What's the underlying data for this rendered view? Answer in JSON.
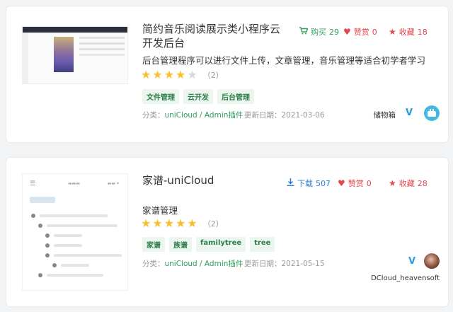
{
  "cards": [
    {
      "title_line1": "简约音乐阅读展示类小程序云",
      "title_line2": "开发后台",
      "stats": {
        "buy_label": "购买",
        "buy_count": "29",
        "like_label": "赞赏",
        "like_count": "0",
        "fav_label": "收藏",
        "fav_count": "18"
      },
      "description": "后台管理程序可以进行文件上传，文章管理，音乐管理等适合初学者学习",
      "rating": 4,
      "rating_count": "（2）",
      "tags": [
        "文件管理",
        "云开发",
        "后台管理"
      ],
      "category_label": "分类：",
      "category_value": "uniCloud / Admin插件",
      "date_label": "更新日期：",
      "date_value": "2021-03-06",
      "author": "储物箱"
    },
    {
      "title": "家谱-uniCloud",
      "stats": {
        "download_label": "下载",
        "download_count": "507",
        "like_label": "赞赏",
        "like_count": "0",
        "fav_label": "收藏",
        "fav_count": "28"
      },
      "description": "家谱管理",
      "rating": 5,
      "rating_count": "（2）",
      "tags": [
        "家谱",
        "族谱",
        "familytree",
        "tree"
      ],
      "category_label": "分类：",
      "category_value": "uniCloud / Admin插件",
      "date_label": "更新日期：",
      "date_value": "2021-05-15",
      "author": "DCloud_heavensoft"
    }
  ],
  "colors": {
    "green": "#2e9e5b",
    "red": "#e0484d",
    "blue": "#2a7fd4",
    "star": "#f6c12b",
    "verified": "#2a9be0"
  },
  "icons": [
    "cart-icon",
    "heart-icon",
    "star-icon",
    "download-icon",
    "verified-icon"
  ]
}
